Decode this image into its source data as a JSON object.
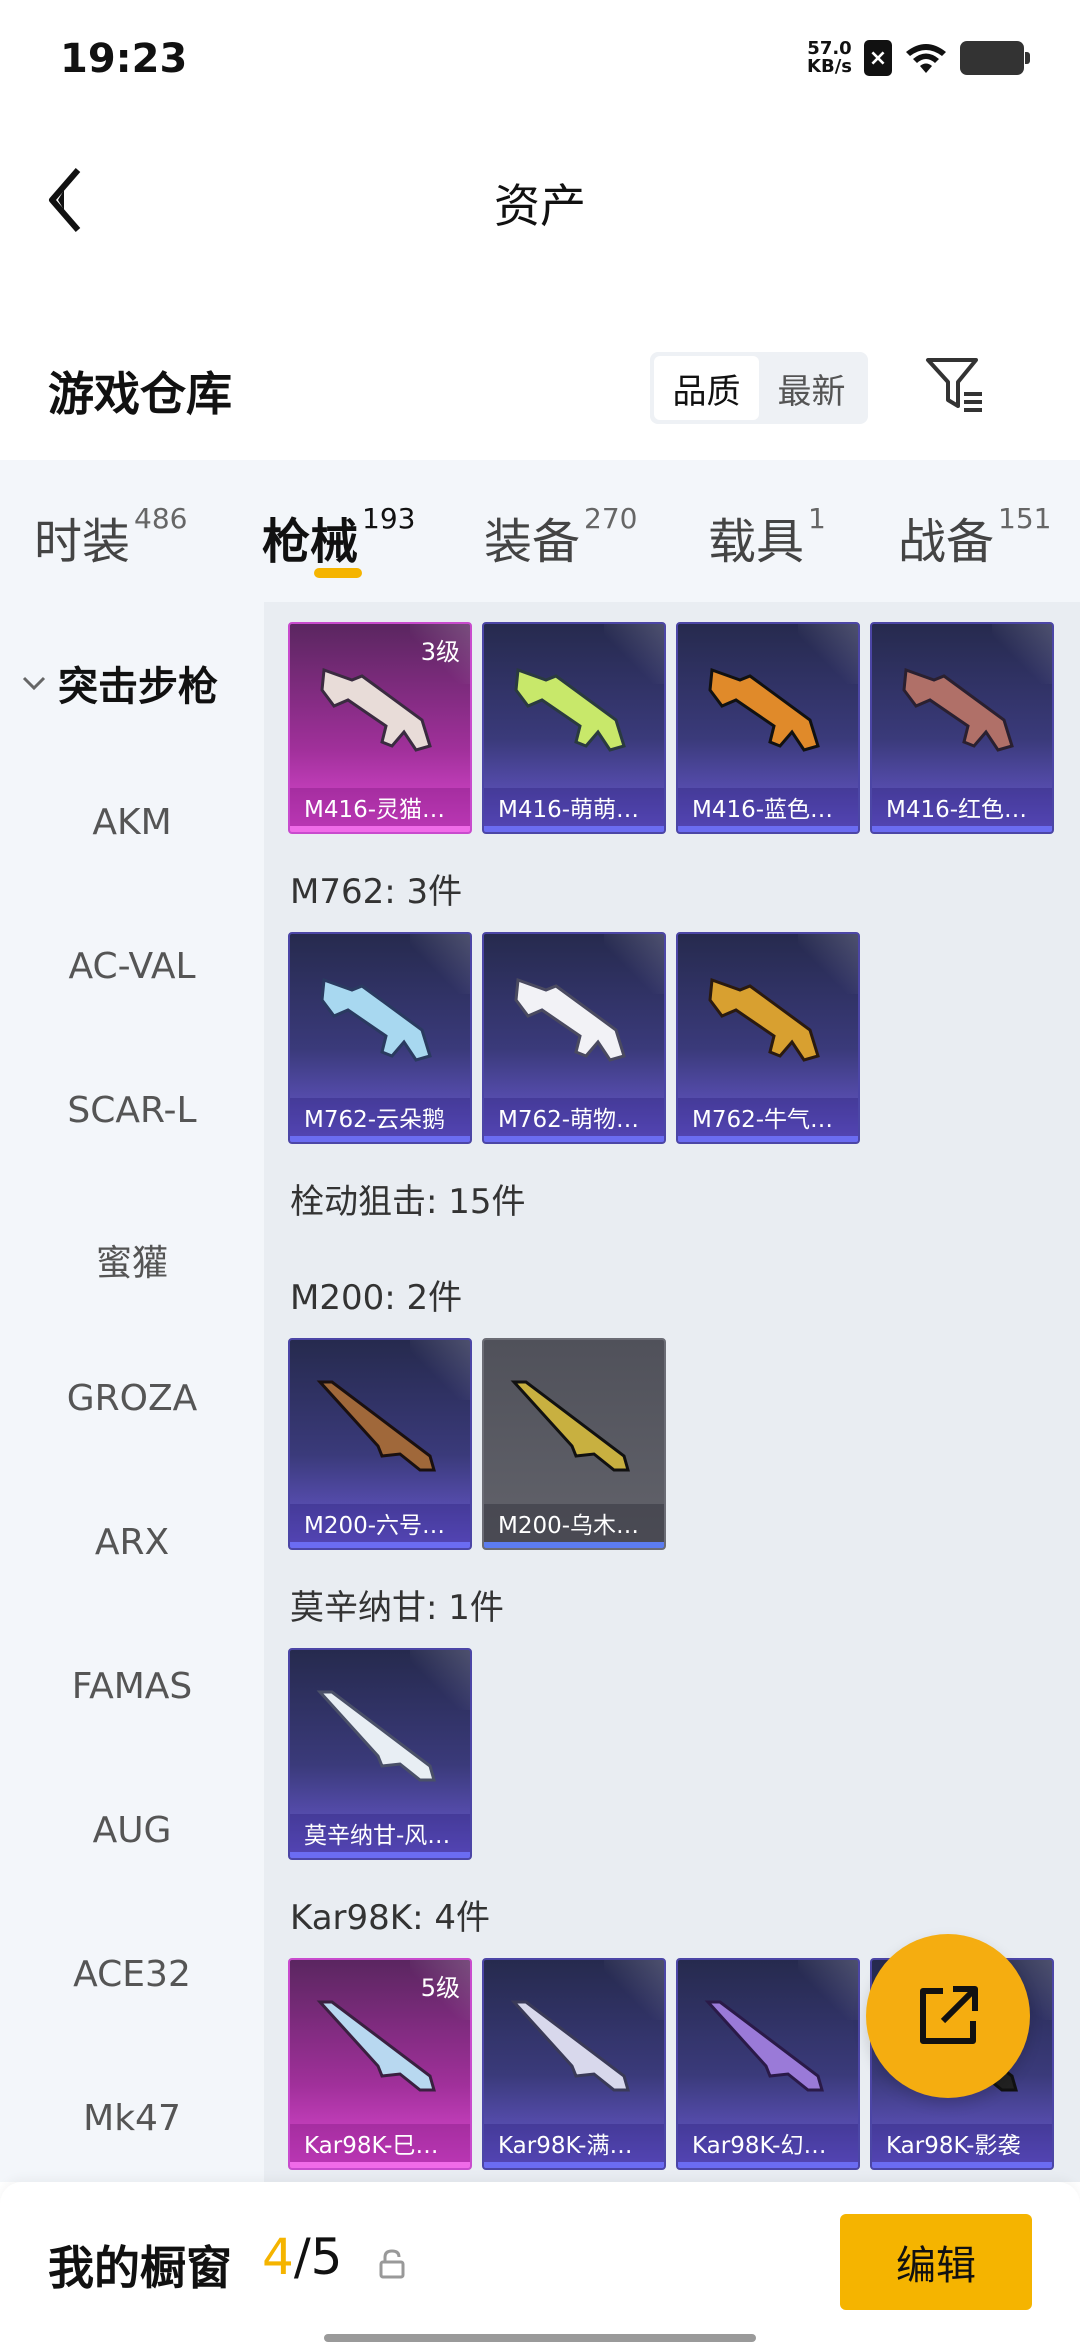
{
  "status_bar": {
    "time": "19:23",
    "net_speed_value": "57.0",
    "net_speed_unit": "KB/s"
  },
  "header": {
    "title": "资产"
  },
  "warehouse": {
    "title": "游戏仓库",
    "sort_options": [
      "品质",
      "最新"
    ],
    "active_sort": "品质"
  },
  "tabs": [
    {
      "label": "时装",
      "count": "486"
    },
    {
      "label": "枪械",
      "count": "193",
      "active": true
    },
    {
      "label": "装备",
      "count": "270"
    },
    {
      "label": "载具",
      "count": "1"
    },
    {
      "label": "战备",
      "count": "151"
    }
  ],
  "sidebar": {
    "category": "突击步枪",
    "items": [
      "AKM",
      "AC-VAL",
      "SCAR-L",
      "蜜獾",
      "GROZA",
      "ARX",
      "FAMAS",
      "AUG",
      "ACE32",
      "Mk47"
    ]
  },
  "groups": [
    {
      "title": "",
      "cards": [
        {
          "name": "M416-灵猫…",
          "level": "3级",
          "rarity": "pink"
        },
        {
          "name": "M416-萌萌…",
          "rarity": "purple"
        },
        {
          "name": "M416-蓝色…",
          "rarity": "purple"
        },
        {
          "name": "M416-红色…",
          "rarity": "purple"
        }
      ]
    },
    {
      "title": "M762: 3件",
      "cards": [
        {
          "name": "M762-云朵鹅",
          "rarity": "purple"
        },
        {
          "name": "M762-萌物…",
          "rarity": "purple"
        },
        {
          "name": "M762-牛气…",
          "rarity": "purple"
        }
      ]
    },
    {
      "title": "栓动狙击: 15件",
      "cards": []
    },
    {
      "title": "M200: 2件",
      "cards": [
        {
          "name": "M200-六号…",
          "rarity": "purple"
        },
        {
          "name": "M200-乌木…",
          "rarity": "gray"
        }
      ]
    },
    {
      "title": "莫辛纳甘: 1件",
      "cards": [
        {
          "name": "莫辛纳甘-风…",
          "rarity": "purple"
        }
      ]
    },
    {
      "title": "Kar98K: 4件",
      "cards": [
        {
          "name": "Kar98K-巳…",
          "level": "5级",
          "rarity": "pink"
        },
        {
          "name": "Kar98K-满…",
          "rarity": "purple"
        },
        {
          "name": "Kar98K-幻…",
          "rarity": "purple"
        },
        {
          "name": "Kar98K-影袭",
          "rarity": "purple"
        }
      ]
    }
  ],
  "bottom_bar": {
    "label": "我的橱窗",
    "current": "4",
    "total": "/5",
    "edit_label": "编辑"
  },
  "colors": {
    "accent": "#f5b400",
    "card_purple": "#6b6cf2",
    "card_pink": "#e04ad6"
  }
}
